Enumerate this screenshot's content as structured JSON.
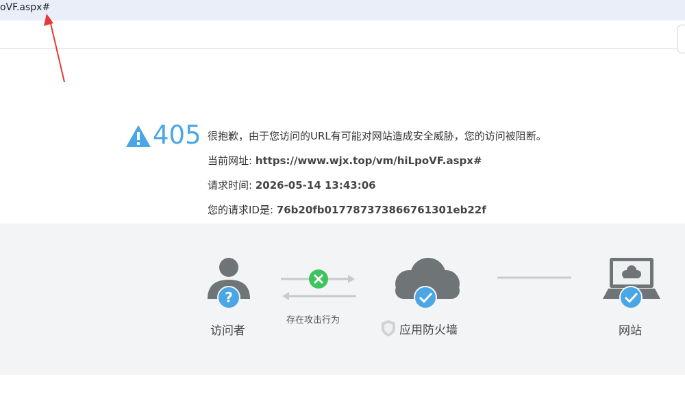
{
  "browser": {
    "url_fragment": "oVF.aspx#"
  },
  "error": {
    "code": "405",
    "message": "很抱歉，由于您访问的URL有可能对网站造成安全威胁，您的访问被阻断。",
    "url_label": "当前网址: ",
    "url_value": "https://www.wjx.top/vm/hiLpoVF.aspx#",
    "time_label": "请求时间: ",
    "time_value": "2026-05-14 13:43:06",
    "reqid_label": "您的请求ID是: ",
    "reqid_value": "76b20fb017787373866761301eb22f"
  },
  "diagram": {
    "visitor_label": "访问者",
    "attack_label": "存在攻击行为",
    "firewall_label": "应用防火墙",
    "website_label": "网站"
  },
  "colors": {
    "accent_blue": "#4aa6e4",
    "gray_icon": "#6f7577",
    "block_green": "#3cc55e",
    "annotation_red": "#e53935"
  },
  "icons": [
    "warning-icon",
    "visitor-icon",
    "question-badge-icon",
    "blocked-x-icon",
    "cloud-firewall-icon",
    "check-badge-icon",
    "shield-icon",
    "website-laptop-icon"
  ]
}
